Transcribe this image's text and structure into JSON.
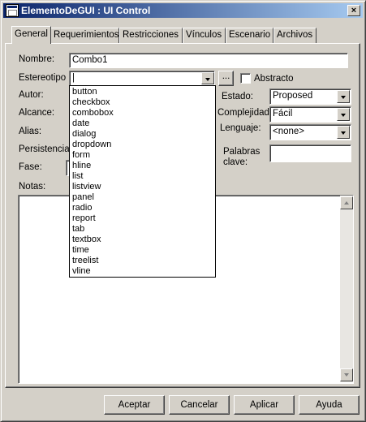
{
  "window": {
    "title": "ElementoDeGUI : UI Control",
    "close_glyph": "×"
  },
  "tabs": [
    {
      "label": "General",
      "active": true
    },
    {
      "label": "Requerimientos"
    },
    {
      "label": "Restricciones"
    },
    {
      "label": "Vínculos"
    },
    {
      "label": "Escenario"
    },
    {
      "label": "Archivos"
    }
  ],
  "form": {
    "nombre_label": "Nombre:",
    "nombre_value": "Combo1",
    "estereotipo_label": "Estereotipo",
    "estereotipo_value": "",
    "ellipsis_label": "...",
    "abstracto_label": "Abstracto",
    "abstracto_checked": false,
    "autor_label": "Autor:",
    "alcance_label": "Alcance:",
    "alias_label": "Alias:",
    "persistencia_label": "Persistencia:",
    "fase_label": "Fase:",
    "estado_label": "Estado:",
    "estado_value": "Proposed",
    "complejidad_label": "Complejidad:",
    "complejidad_value": "Fácil",
    "lenguaje_label": "Lenguaje:",
    "lenguaje_value": "<none>",
    "palabras_clave_label_1": "Palabras",
    "palabras_clave_label_2": "clave:",
    "palabras_clave_value": "",
    "notas_label": "Notas:"
  },
  "stereotype_options": [
    "button",
    "checkbox",
    "combobox",
    "date",
    "dialog",
    "dropdown",
    "form",
    "hline",
    "list",
    "listview",
    "panel",
    "radio",
    "report",
    "tab",
    "textbox",
    "time",
    "treelist",
    "vline"
  ],
  "footer": {
    "aceptar": "Aceptar",
    "cancelar": "Cancelar",
    "aplicar": "Aplicar",
    "ayuda": "Ayuda"
  },
  "colors": {
    "face": "#d4d0c8",
    "title_start": "#0a246a",
    "title_end": "#a6caf0"
  }
}
